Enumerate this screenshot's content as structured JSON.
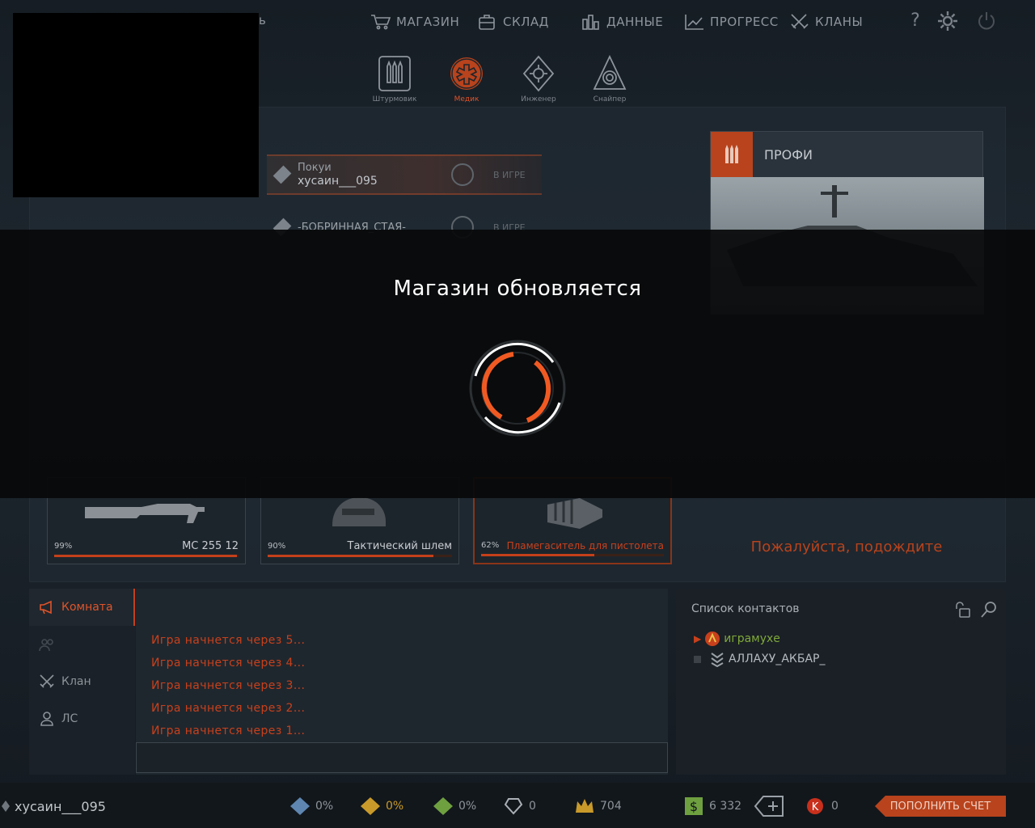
{
  "nav": {
    "items": [
      {
        "label": "МАГАЗИН",
        "icon": "cart-icon"
      },
      {
        "label": "СКЛАД",
        "icon": "bag-icon"
      },
      {
        "label": "ДАННЫЕ",
        "icon": "bars-icon"
      },
      {
        "label": "ПРОГРЕСС",
        "icon": "progress-icon"
      },
      {
        "label": "КЛАНЫ",
        "icon": "swords-icon"
      }
    ],
    "help": "?",
    "left_fragment": "ь"
  },
  "classes": [
    {
      "label": "Штурмовик",
      "icon": "ammo-icon"
    },
    {
      "label": "Медик",
      "icon": "medic-icon"
    },
    {
      "label": "Инженер",
      "icon": "gear-icon"
    },
    {
      "label": "Снайпер",
      "icon": "scope-icon"
    }
  ],
  "players": [
    {
      "line1": "Покуи",
      "line2": "хусаин___095",
      "status": "В ИГРЕ"
    },
    {
      "line1": "-БОБРИННАЯ_СТАЯ-",
      "line2": "",
      "status": "В ИГРЕ"
    }
  ],
  "profi": {
    "title": "ПРОФИ"
  },
  "items": [
    {
      "pct": "99%",
      "name": "МС 255 12",
      "fill": 0.99
    },
    {
      "pct": "90%",
      "name": "Тактический шлем",
      "fill": 0.9
    },
    {
      "pct": "62%",
      "name": "Пламегаситель для пистолета",
      "fill": 0.62
    }
  ],
  "wait_text": "Пожалуйста, подождите",
  "overlay": {
    "title": "Магазин обновляется"
  },
  "chat": {
    "tabs": [
      {
        "label": "Комната",
        "icon": "megaphone-icon",
        "active": true
      },
      {
        "label": "",
        "icon": "team-icon",
        "active": false
      },
      {
        "label": "Клан",
        "icon": "swords-icon",
        "active": false
      },
      {
        "label": "ЛС",
        "icon": "person-icon",
        "active": false
      }
    ],
    "lines": [
      "Игра начнется через  5...",
      "Игра начнется через  4...",
      "Игра начнется через  3...",
      "Игра начнется через  2...",
      "Игра начнется через  1..."
    ],
    "input_value": ""
  },
  "contacts": {
    "title": "Список контактов",
    "items": [
      {
        "name": "играмухе",
        "color": "#7fa83a"
      },
      {
        "name": "АЛЛАХУ_АКБАР_",
        "color": "#aab0b6"
      }
    ]
  },
  "bottom": {
    "username": "хусаин___095",
    "stats": [
      {
        "value": "0%",
        "icon": "booster-xp-icon",
        "color": "#5e86b0"
      },
      {
        "value": "0%",
        "icon": "booster-money-icon",
        "color": "#c99a2a"
      },
      {
        "value": "0%",
        "icon": "booster-sp-icon",
        "color": "#6fa040"
      },
      {
        "value": "0",
        "icon": "heart-icon",
        "color": "#aab0b6"
      },
      {
        "value": "704",
        "icon": "crown-icon",
        "color": "#c99a2a"
      },
      {
        "value": "6 332",
        "icon": "dollar-icon",
        "color": "#6fa040"
      },
      {
        "value": "0",
        "icon": "k-coin-icon",
        "color": "#c8301c"
      }
    ],
    "topup_label": "ПОПОЛНИТЬ СЧЕТ"
  },
  "colors": {
    "accent": "#e0542a",
    "chat_text": "#c8401c"
  }
}
